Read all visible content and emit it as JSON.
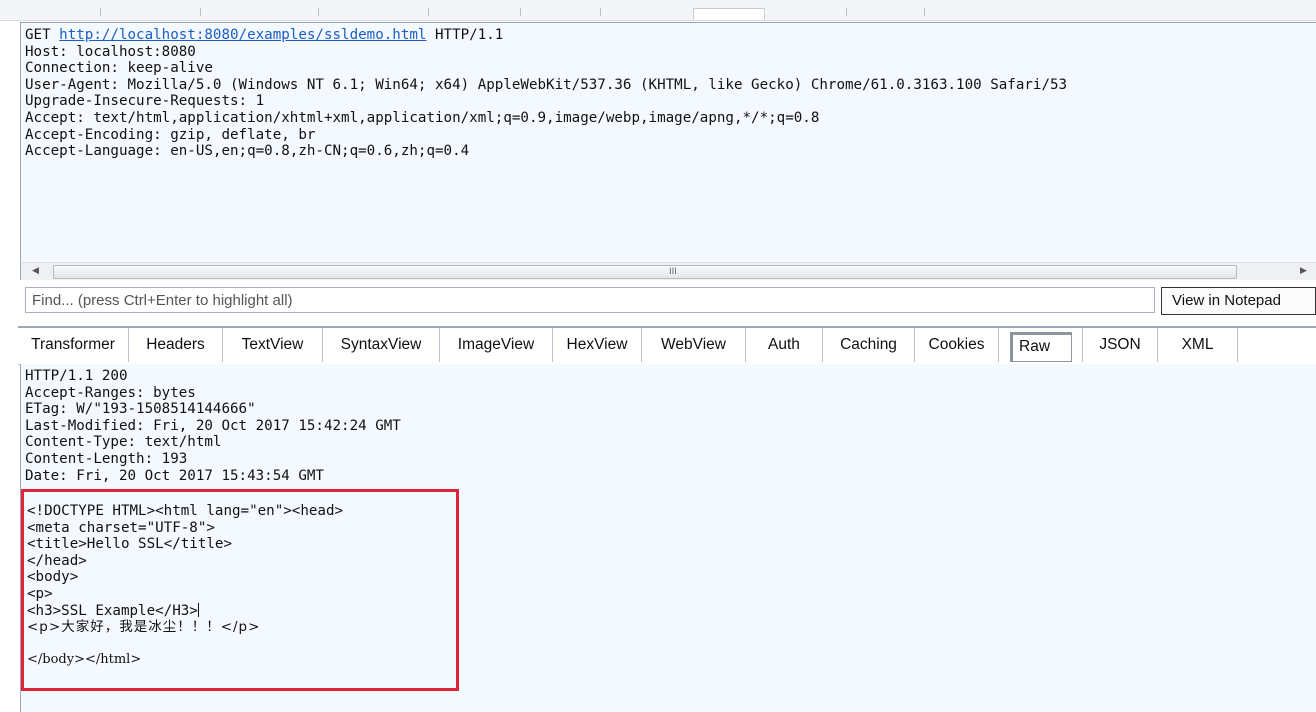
{
  "request": {
    "method": "GET",
    "url": "http://localhost:8080/examples/ssldemo.html",
    "protocol": "HTTP/1.1",
    "headers": [
      "Host: localhost:8080",
      "Connection: keep-alive",
      "User-Agent: Mozilla/5.0 (Windows NT 6.1; Win64; x64) AppleWebKit/537.36 (KHTML, like Gecko) Chrome/61.0.3163.100 Safari/53",
      "Upgrade-Insecure-Requests: 1",
      "Accept: text/html,application/xhtml+xml,application/xml;q=0.9,image/webp,image/apng,*/*;q=0.8",
      "Accept-Encoding: gzip, deflate, br",
      "Accept-Language: en-US,en;q=0.8,zh-CN;q=0.6,zh;q=0.4"
    ]
  },
  "scrollbar": {
    "grip": "III",
    "left_arrow": "◀",
    "right_arrow": "▶"
  },
  "find_bar": {
    "placeholder": "Find... (press Ctrl+Enter to highlight all)",
    "notepad_button": "View in Notepad"
  },
  "tabs": {
    "transformer": "Transformer",
    "headers": "Headers",
    "textview": "TextView",
    "syntaxview": "SyntaxView",
    "imageview": "ImageView",
    "hexview": "HexView",
    "webview": "WebView",
    "auth": "Auth",
    "caching": "Caching",
    "cookies": "Cookies",
    "raw": "Raw",
    "json": "JSON",
    "xml": "XML",
    "active": "Raw"
  },
  "response": {
    "headers": [
      "HTTP/1.1 200",
      "Accept-Ranges: bytes",
      "ETag: W/\"193-1508514144666\"",
      "Last-Modified: Fri, 20 Oct 2017 15:42:24 GMT",
      "Content-Type: text/html",
      "Content-Length: 193",
      "Date: Fri, 20 Oct 2017 15:43:54 GMT"
    ],
    "body": {
      "l1": "<!DOCTYPE HTML><html lang=\"en\"><head>",
      "l2": "<meta charset=\"UTF-8\">",
      "l3": "<title>Hello SSL</title>",
      "l4": "</head>",
      "l5": "<body>",
      "l6": "<p>",
      "l7": "<h3>SSL Example</H3>",
      "l8": "<p>大家好，我是冰尘！！！</p>",
      "l9": "",
      "l10": "</body></html>"
    }
  },
  "colors": {
    "pane_bg": "#f4f9ff",
    "link": "#1a5ec8",
    "highlight_border": "#e0253a"
  }
}
